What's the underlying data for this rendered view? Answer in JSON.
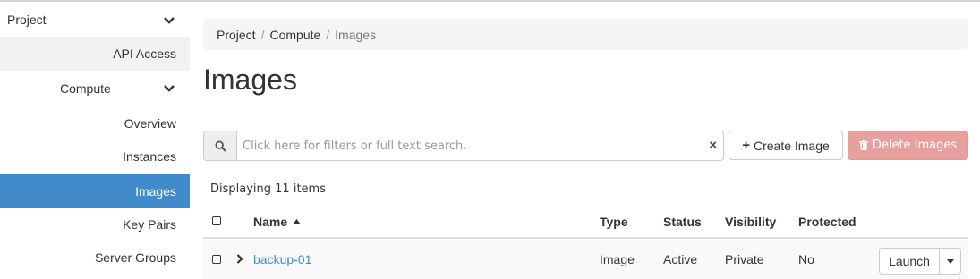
{
  "sidebar": {
    "project": "Project",
    "api_access": "API Access",
    "compute": "Compute",
    "items": [
      "Overview",
      "Instances",
      "Images",
      "Key Pairs",
      "Server Groups"
    ],
    "active_item": "Images",
    "active_color": "#428bca"
  },
  "breadcrumb": [
    "Project",
    "Compute",
    "Images"
  ],
  "page_title": "Images",
  "search": {
    "placeholder": "Click here for filters or full text search."
  },
  "buttons": {
    "create_image": "Create Image",
    "delete_images": "Delete Images"
  },
  "table": {
    "count": "Displaying 11 items",
    "columns": [
      "Name",
      "Type",
      "Status",
      "Visibility",
      "Protected"
    ],
    "rows": [
      {
        "name": "backup-01",
        "type": "Image",
        "status": "Active",
        "visibility": "Private",
        "protected": "No",
        "action": "Launch"
      }
    ]
  }
}
